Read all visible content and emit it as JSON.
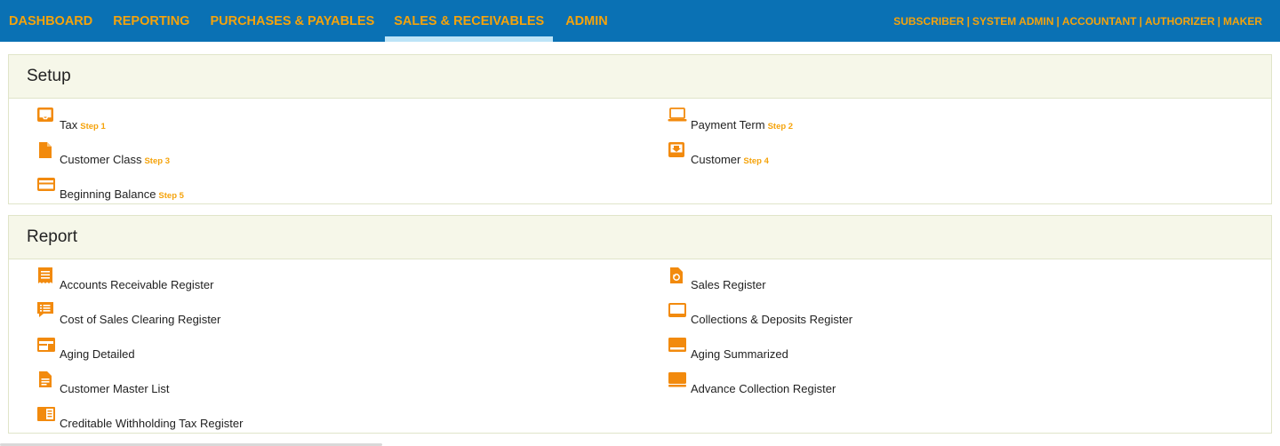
{
  "nav": {
    "items": [
      {
        "label": "DASHBOARD"
      },
      {
        "label": "REPORTING"
      },
      {
        "label": "PURCHASES & PAYABLES"
      },
      {
        "label": "SALES & RECEIVABLES"
      },
      {
        "label": "ADMIN"
      }
    ],
    "active": "SALES & RECEIVABLES"
  },
  "roles": [
    "SUBSCRIBER",
    "SYSTEM ADMIN",
    "ACCOUNTANT",
    "AUTHORIZER",
    "MAKER"
  ],
  "colors": {
    "bar": "#0a71b4",
    "accent": "#f5a30b",
    "active_underline": "#bde4f7"
  },
  "setup": {
    "title": "Setup",
    "items": [
      {
        "label": "Tax",
        "step": "Step 1",
        "icon": "inbox-icon"
      },
      {
        "label": "Payment Term",
        "step": "Step 2",
        "icon": "laptop-icon"
      },
      {
        "label": "Customer Class",
        "step": "Step 3",
        "icon": "file-icon"
      },
      {
        "label": "Customer",
        "step": "Step 4",
        "icon": "download-box-icon"
      },
      {
        "label": "Beginning Balance",
        "step": "Step 5",
        "icon": "credit-card-icon"
      }
    ]
  },
  "report": {
    "title": "Report",
    "items": [
      {
        "label": "Accounts Receivable Register",
        "icon": "receipt-icon"
      },
      {
        "label": "Sales Register",
        "icon": "file-refresh-icon"
      },
      {
        "label": "Cost of Sales Clearing Register",
        "icon": "list-chat-icon"
      },
      {
        "label": "Collections & Deposits Register",
        "icon": "tablet-icon"
      },
      {
        "label": "Aging Detailed",
        "icon": "window-icon"
      },
      {
        "label": "Aging Summarized",
        "icon": "browser-icon"
      },
      {
        "label": "Customer Master List",
        "icon": "document-icon"
      },
      {
        "label": "Advance Collection Register",
        "icon": "screen-icon"
      },
      {
        "label": "Creditable Withholding Tax Register",
        "icon": "book-icon"
      }
    ]
  }
}
